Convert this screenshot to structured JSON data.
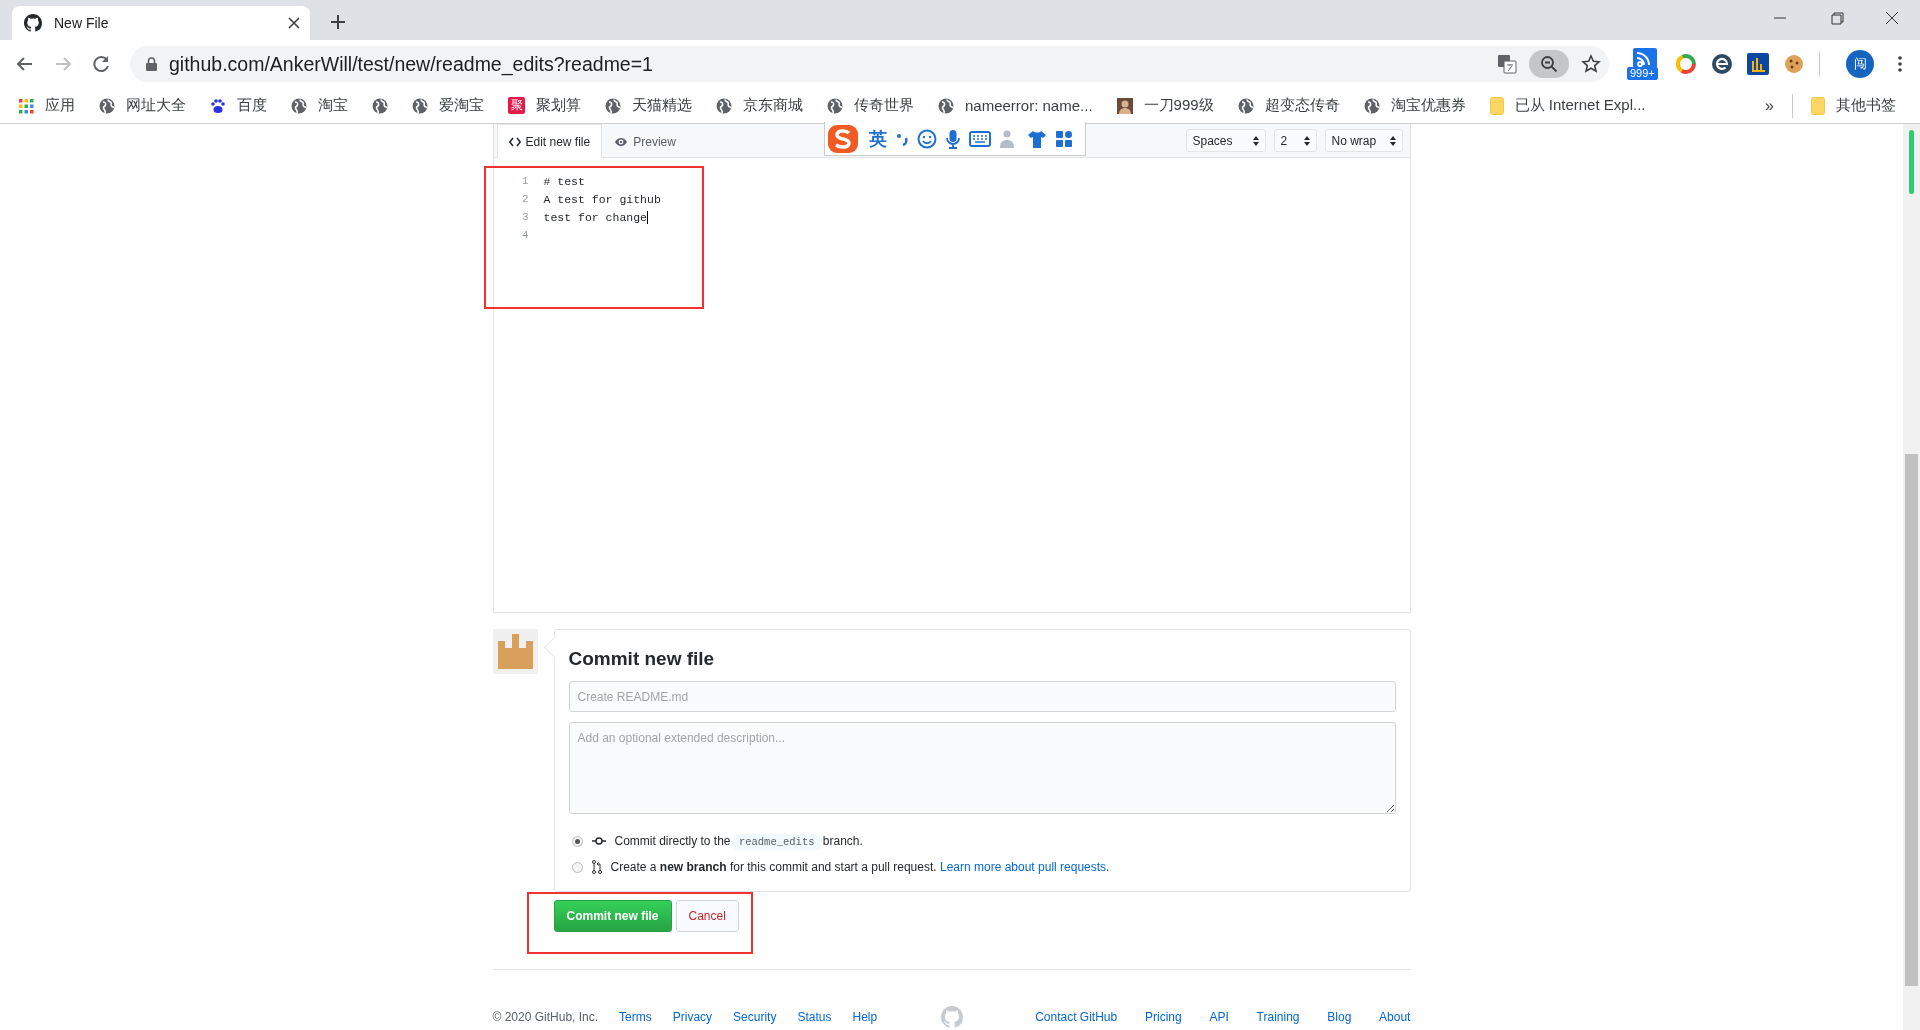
{
  "browser": {
    "tab_title": "New File",
    "url": "github.com/AnkerWill/test/new/readme_edits?readme=1",
    "extension_badge": "999+",
    "profile_initial": "闯",
    "bookmarks": [
      {
        "kind": "apps",
        "label": "应用"
      },
      {
        "kind": "globe",
        "label": "网址大全"
      },
      {
        "kind": "paw",
        "label": "百度"
      },
      {
        "kind": "globe",
        "label": "淘宝"
      },
      {
        "kind": "globe"
      },
      {
        "kind": "globe",
        "label": "爱淘宝"
      },
      {
        "kind": "ju",
        "icon_text": "聚",
        "label": "聚划算"
      },
      {
        "kind": "globe",
        "label": "天猫精选"
      },
      {
        "kind": "globe",
        "label": "京东商城"
      },
      {
        "kind": "globe",
        "label": "传奇世界"
      },
      {
        "kind": "globe",
        "label": "nameerror: name..."
      },
      {
        "kind": "portrait",
        "label": "一刀999级"
      },
      {
        "kind": "globe",
        "label": "超变态传奇"
      },
      {
        "kind": "globe",
        "label": "淘宝优惠券"
      },
      {
        "kind": "folder",
        "label": "已从 Internet Expl..."
      }
    ],
    "overflow": "»",
    "other_bookmarks": "其他书签"
  },
  "editor": {
    "tabs": [
      {
        "label": "Edit new file",
        "selected": true
      },
      {
        "label": "Preview",
        "selected": false
      }
    ],
    "ime": {
      "lang": "英"
    },
    "selects": [
      "Spaces",
      "2",
      "No wrap"
    ],
    "lines": [
      {
        "number": "1",
        "text": "# test",
        "cursor": false
      },
      {
        "number": "2",
        "text": "A test for github",
        "cursor": false
      },
      {
        "number": "3",
        "text": "test for change",
        "cursor": true
      },
      {
        "number": "4",
        "cursor": false
      }
    ]
  },
  "commit": {
    "title": "Commit new file",
    "summary_placeholder": "Create README.md",
    "description_placeholder": "Add an optional extended description...",
    "options": [
      {
        "kind": "direct",
        "selected": true,
        "text": "Commit directly to the",
        "branch": "readme_edits",
        "after": "branch."
      },
      {
        "kind": "new_branch",
        "selected": false,
        "text": "Create a **new branch** for this commit and start a pull request.",
        "link": "Learn more about pull requests."
      }
    ],
    "submit": "Commit new file",
    "cancel": "Cancel"
  },
  "footer": {
    "copyright": "© 2020 GitHub, Inc.",
    "left_links": [
      "Terms",
      "Privacy",
      "Security",
      "Status",
      "Help"
    ],
    "right_links": [
      "Contact GitHub",
      "Pricing",
      "API",
      "Training",
      "Blog",
      "About"
    ]
  }
}
